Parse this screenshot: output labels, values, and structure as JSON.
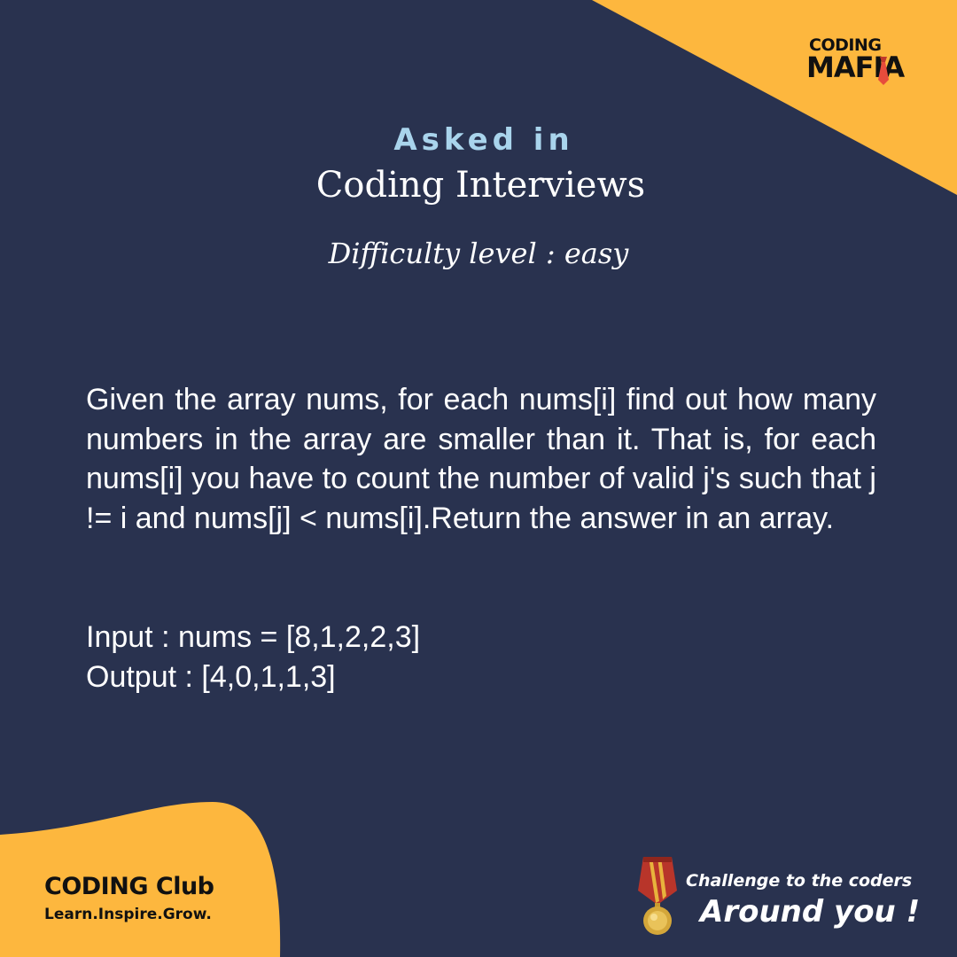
{
  "colors": {
    "background": "#29324f",
    "accent": "#fdb73e",
    "heading_accent": "#a9d4ec",
    "text": "#ffffff"
  },
  "brand": {
    "top_logo": {
      "line1": "CODING",
      "line2": "MAFIA",
      "icon": "tie-icon"
    },
    "bottom_logo": {
      "name": "CODING Club",
      "tagline": "Learn.Inspire.Grow.",
      "icon": "tie-icon"
    }
  },
  "header": {
    "asked_in": "Asked in",
    "subtitle": "Coding Interviews",
    "difficulty": "Difficulty level : easy"
  },
  "problem": {
    "statement": "Given the array nums, for each nums[i] find out how many numbers in the array are smaller than it. That is, for each nums[i] you have to count the number of valid j's such that j != i and nums[j] < nums[i].Return the answer in an array.",
    "input": "Input : nums = [8,1,2,2,3]",
    "output": "Output : [4,0,1,1,3]"
  },
  "footer": {
    "challenge_line": "Challenge to the coders",
    "around_line": "Around you !",
    "icon": "medal-icon"
  }
}
